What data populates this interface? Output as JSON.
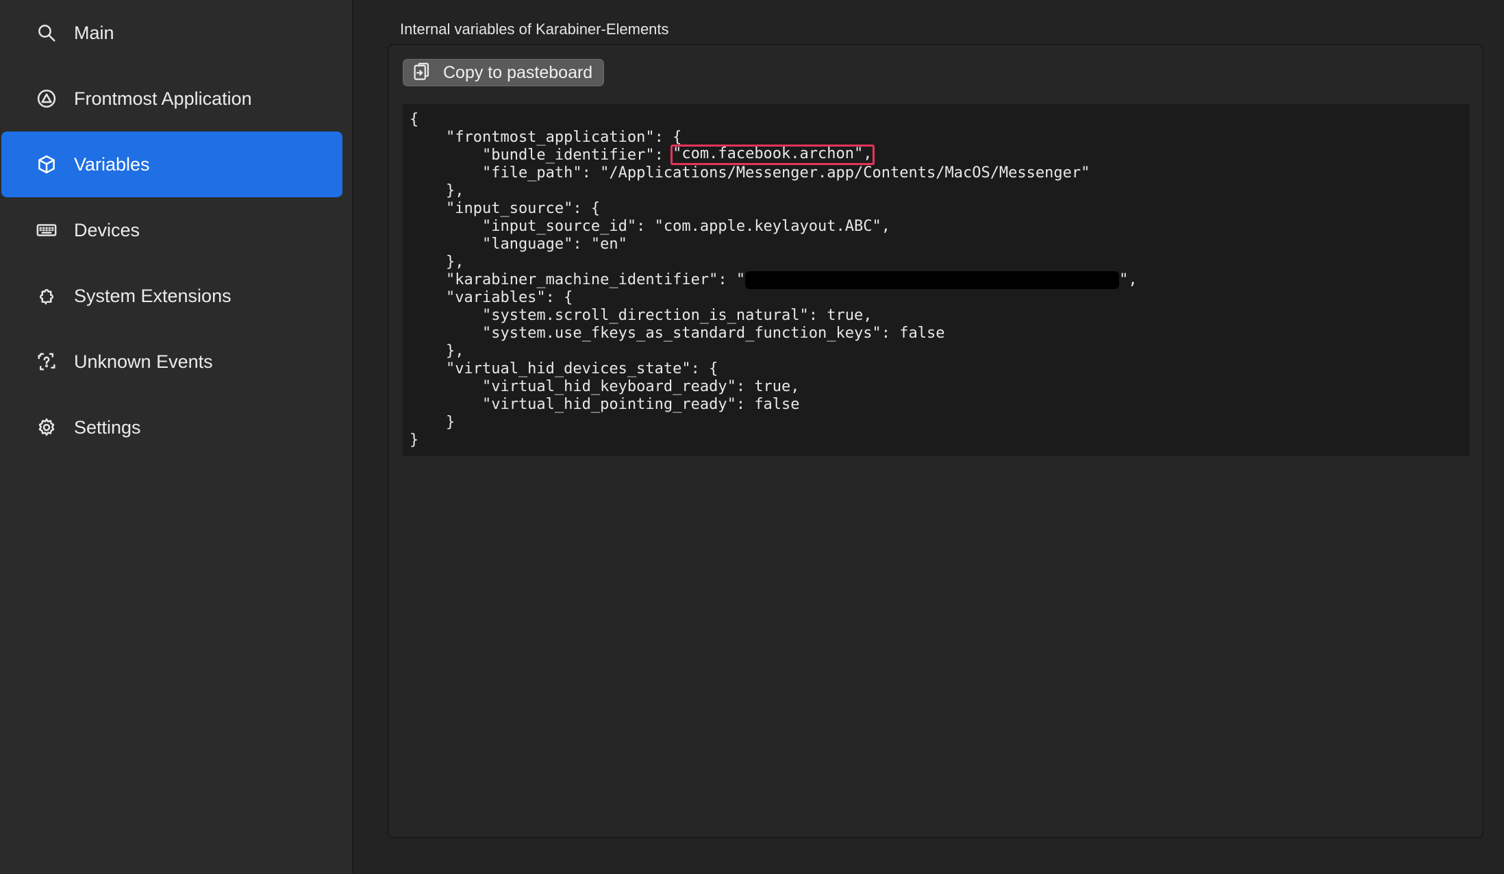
{
  "sidebar": {
    "items": [
      {
        "label": "Main",
        "icon": "search-icon",
        "active": false
      },
      {
        "label": "Frontmost Application",
        "icon": "app-triangle-icon",
        "active": false
      },
      {
        "label": "Variables",
        "icon": "cube-icon",
        "active": true
      },
      {
        "label": "Devices",
        "icon": "keyboard-icon",
        "active": false
      },
      {
        "label": "System Extensions",
        "icon": "puzzle-icon",
        "active": false
      },
      {
        "label": "Unknown Events",
        "icon": "question-square-icon",
        "active": false
      },
      {
        "label": "Settings",
        "icon": "gear-icon",
        "active": false
      }
    ]
  },
  "main": {
    "title": "Internal variables of Karabiner-Elements",
    "copy_button_label": "Copy to pasteboard",
    "code": {
      "line1": "{",
      "line2": "    \"frontmost_application\": {",
      "line3_key": "        \"bundle_identifier\": ",
      "line3_value": "\"com.facebook.archon\",",
      "line4": "        \"file_path\": \"/Applications/Messenger.app/Contents/MacOS/Messenger\"",
      "line5": "    },",
      "line6": "    \"input_source\": {",
      "line7": "        \"input_source_id\": \"com.apple.keylayout.ABC\",",
      "line8": "        \"language\": \"en\"",
      "line9": "    },",
      "line10_key": "    \"karabiner_machine_identifier\": \"",
      "line10_end": "\",",
      "line11": "    \"variables\": {",
      "line12": "        \"system.scroll_direction_is_natural\": true,",
      "line13": "        \"system.use_fkeys_as_standard_function_keys\": false",
      "line14": "    },",
      "line15": "    \"virtual_hid_devices_state\": {",
      "line16": "        \"virtual_hid_keyboard_ready\": true,",
      "line17": "        \"virtual_hid_pointing_ready\": false",
      "line18": "    }",
      "line19": "}"
    }
  },
  "colors": {
    "accent": "#1f6fe5",
    "highlight": "#e8345a"
  }
}
